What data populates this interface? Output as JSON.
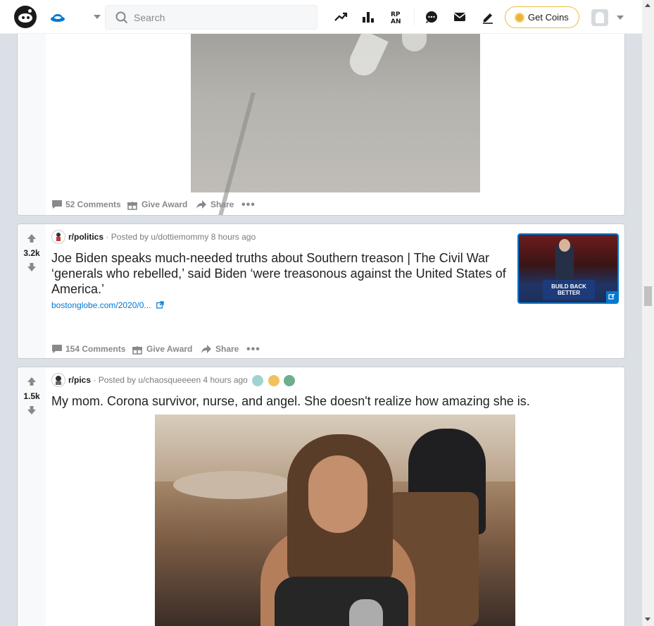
{
  "header": {
    "search_placeholder": "Search",
    "get_coins_label": "Get Coins",
    "icons": [
      "reddit-logo-icon",
      "home-icon",
      "popular-icon",
      "leaderboard-icon",
      "rpan-icon",
      "chat-icon",
      "messages-icon",
      "create-post-icon",
      "coin-icon",
      "avatar-icon"
    ]
  },
  "posts": [
    {
      "comments_label": "52 Comments",
      "give_award_label": "Give Award",
      "share_label": "Share"
    },
    {
      "score": "3.2k",
      "subreddit": "r/politics",
      "posted_by": "· Posted by u/dottiemommy 8 hours ago",
      "title": "Joe Biden speaks much-needed truths about Southern treason | The Civil War ‘generals who rebelled,’ said Biden ‘were treasonous against the United States of America.’",
      "link": "bostonglobe.com/2020/0...",
      "thumbnail_text": "BUILD BACK BETTER",
      "comments_label": "154 Comments",
      "give_award_label": "Give Award",
      "share_label": "Share"
    },
    {
      "score": "1.5k",
      "subreddit": "r/pics",
      "posted_by": "· Posted by u/chaosqueeeen 4 hours ago",
      "title": "My mom. Corona survivor, nurse, and angel. She doesn't realize how amazing she is."
    }
  ],
  "colors": {
    "accent": "#0079d3",
    "background": "#dae0e6",
    "coin_border": "#e9c13e"
  }
}
